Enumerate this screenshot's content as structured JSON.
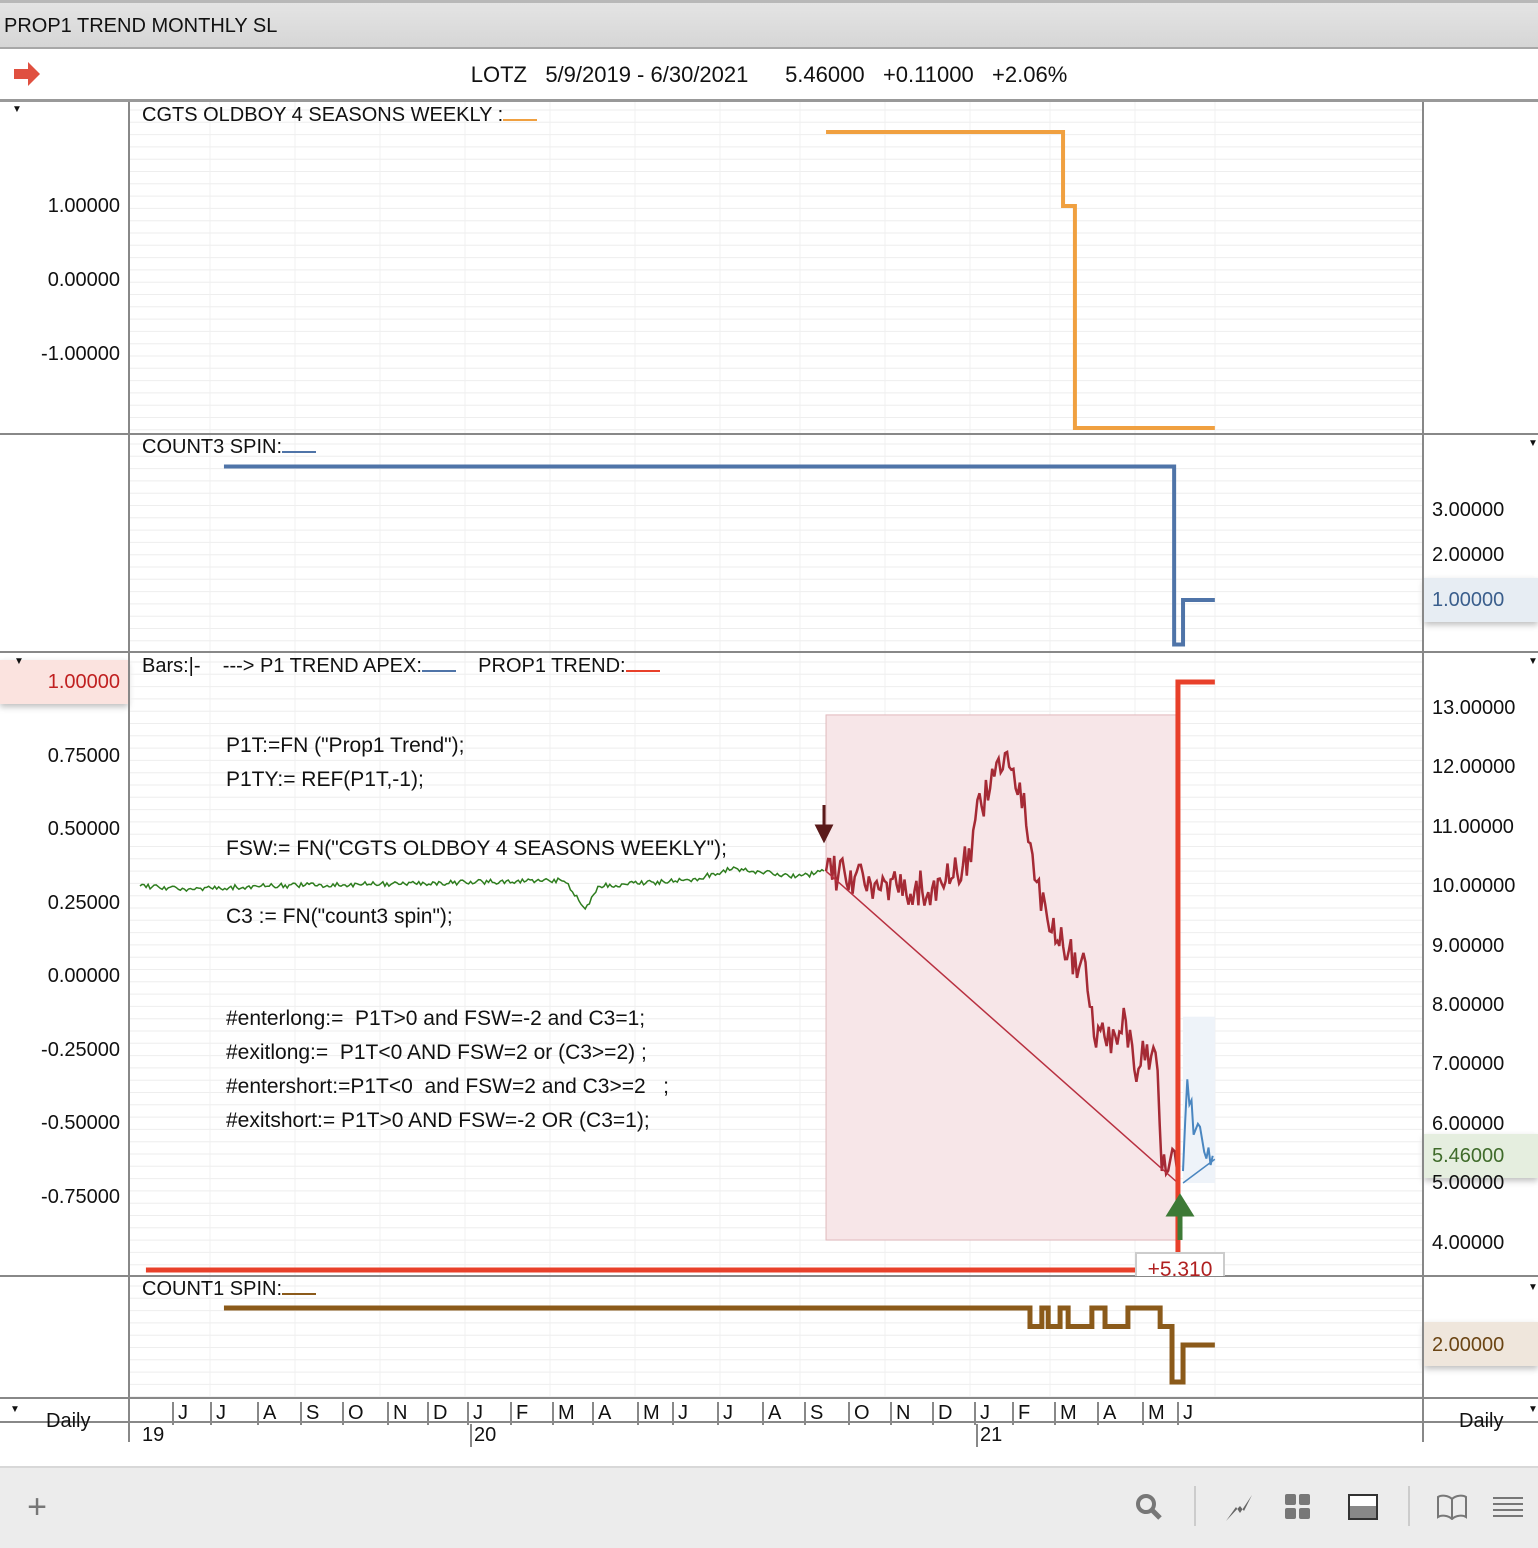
{
  "window": {
    "title": "PROP1 TREND MONTHLY SL"
  },
  "header": {
    "symbol": "LOTZ",
    "date_range": "5/9/2019 - 6/30/2021",
    "last": "5.46000",
    "change": "+0.11000",
    "change_pct": "+2.06%"
  },
  "panels": {
    "p1": {
      "title": "CGTS OLDBOY 4 SEASONS WEEKLY :",
      "color": "#f0a040",
      "left_axis": [
        "1.00000",
        "0.00000",
        "-1.00000"
      ],
      "steps": [
        [
          16.18,
          2
        ],
        [
          21.77,
          1
        ],
        [
          22.05,
          -2
        ],
        [
          25.35,
          -2
        ]
      ]
    },
    "p2": {
      "title": "COUNT3 SPIN:",
      "color": "#4f74a8",
      "right_axis": [
        "3.00000",
        "2.00000",
        "1.00000"
      ],
      "current": "1.00000",
      "steps": [
        [
          1.98,
          4
        ],
        [
          24.39,
          0
        ],
        [
          24.6,
          1
        ],
        [
          25.35,
          1
        ]
      ]
    },
    "p3": {
      "title_bars": "Bars:|-",
      "title_apex": "---> P1 TREND APEX:",
      "title_trend": "PROP1 TREND:",
      "apex_color": "#4f74a8",
      "trend_color": "#e8402a",
      "left_axis": [
        "1.00000",
        "0.75000",
        "0.50000",
        "0.25000",
        "0.00000",
        "-0.25000",
        "-0.50000",
        "-0.75000"
      ],
      "left_current": "1.00000",
      "right_axis": [
        "13.00000",
        "12.00000",
        "11.00000",
        "10.00000",
        "9.00000",
        "8.00000",
        "7.00000",
        "6.00000",
        "5.00000",
        "4.00000"
      ],
      "right_current": "5.46000",
      "trade_label": "+5.310",
      "trend_steps": [
        [
          0.14,
          -1
        ],
        [
          24.48,
          1
        ],
        [
          25.35,
          1
        ]
      ],
      "code": [
        "P1T:=FN (\"Prop1 Trend\");",
        "P1TY:= REF(P1T,-1);",
        "",
        "FSW:= FN(\"CGTS OLDBOY 4 SEASONS WEEKLY\");",
        "",
        "C3 := FN(\"count3 spin\");",
        "",
        "",
        "#enterlong:=  P1T>0 and FSW=-2 and C3=1;",
        "#exitlong:=  P1T<0 AND FSW=2 or (C3>=2) ;",
        "#entershort:=P1T<0  and FSW=2 and C3>=2   ;",
        "#exitshort:= P1T>0 AND FSW=-2 OR (C3=1);"
      ],
      "price_green": [
        [
          0,
          10.0
        ],
        [
          1,
          9.95
        ],
        [
          3,
          10.0
        ],
        [
          7,
          10.05
        ],
        [
          10,
          10.1
        ],
        [
          10.3,
          9.8
        ],
        [
          10.5,
          9.6
        ],
        [
          10.8,
          10.0
        ],
        [
          13,
          10.1
        ],
        [
          14,
          10.3
        ],
        [
          15.5,
          10.15
        ],
        [
          16.18,
          10.25
        ]
      ],
      "price_red": [
        [
          16.18,
          10.25
        ],
        [
          17,
          10.1
        ],
        [
          18.5,
          9.95
        ],
        [
          19,
          10.05
        ],
        [
          19.5,
          10.4
        ],
        [
          19.8,
          11.3
        ],
        [
          20.2,
          11.8
        ],
        [
          20.5,
          12.3
        ],
        [
          20.8,
          11.5
        ],
        [
          21.2,
          10.0
        ],
        [
          21.5,
          9.2
        ],
        [
          22,
          8.8
        ],
        [
          22.3,
          8.6
        ],
        [
          22.5,
          7.5
        ],
        [
          22.9,
          7.4
        ],
        [
          23.2,
          7.8
        ],
        [
          23.5,
          7.0
        ],
        [
          23.8,
          7.2
        ],
        [
          24.0,
          6.8
        ],
        [
          24.1,
          5.4
        ],
        [
          24.3,
          5.3
        ],
        [
          24.5,
          5.2
        ]
      ],
      "price_blue": [
        [
          24.6,
          5.2
        ],
        [
          24.7,
          6.6
        ],
        [
          24.85,
          6.0
        ],
        [
          25.1,
          5.6
        ],
        [
          25.35,
          5.4
        ]
      ],
      "short_trade": {
        "entry": [
          16.18,
          10.25
        ],
        "exit": [
          24.48,
          5.0
        ]
      },
      "long_trade": {
        "entry": [
          24.6,
          5.0
        ],
        "exit": [
          25.35,
          5.4
        ]
      }
    },
    "p4": {
      "title": "COUNT1 SPIN:",
      "color": "#8b5a1a",
      "right_current": "2.00000",
      "steps": [
        [
          1.98,
          3
        ],
        [
          20.99,
          2.5
        ],
        [
          21.27,
          3
        ],
        [
          21.42,
          2.5
        ],
        [
          21.7,
          3
        ],
        [
          21.89,
          2.5
        ],
        [
          22.45,
          3
        ],
        [
          22.76,
          2.5
        ],
        [
          23.3,
          3
        ],
        [
          24.06,
          2.5
        ],
        [
          24.34,
          1
        ],
        [
          24.6,
          2
        ],
        [
          25.35,
          2
        ]
      ]
    }
  },
  "xaxis": {
    "period_left": "Daily",
    "period_right": "Daily",
    "months": [
      "J",
      "J",
      "A",
      "S",
      "O",
      "N",
      "D",
      "J",
      "F",
      "M",
      "A",
      "M",
      "J",
      "J",
      "A",
      "S",
      "O",
      "N",
      "D",
      "J",
      "F",
      "M",
      "A",
      "M",
      "J"
    ],
    "years": [
      "19",
      "20",
      "21"
    ]
  }
}
